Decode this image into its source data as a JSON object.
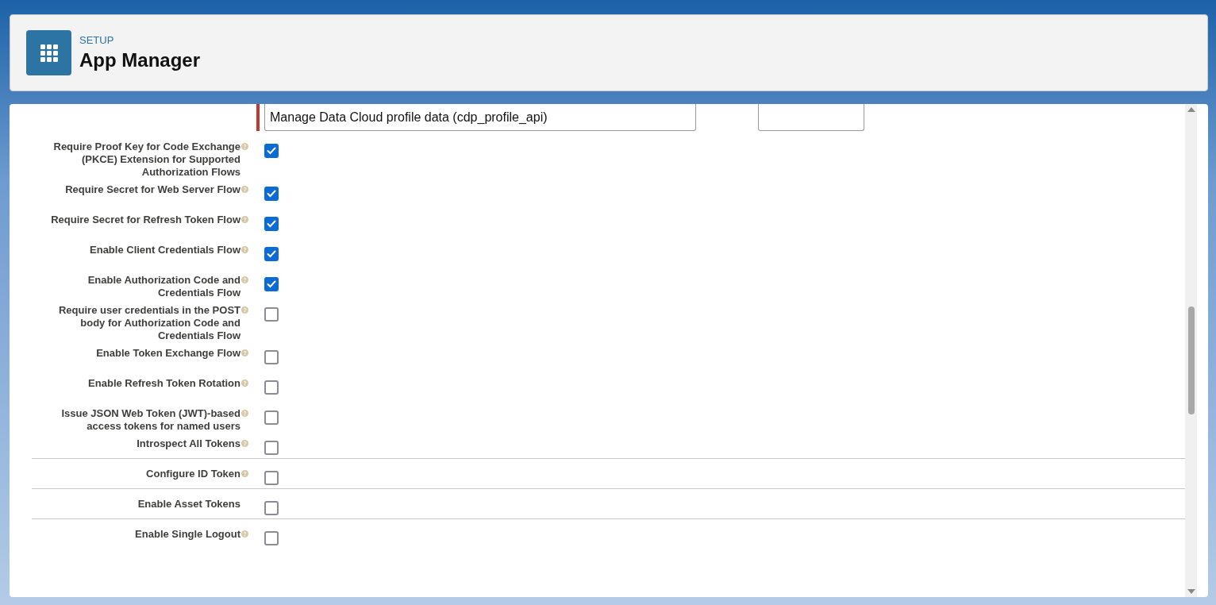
{
  "header": {
    "eyebrow": "SETUP",
    "title": "App Manager"
  },
  "scopes": {
    "selected_item": "Manage Data Cloud profile data (cdp_profile_api)",
    "required": true
  },
  "settings": [
    {
      "label": "Require Proof Key for Code Exchange (PKCE) Extension for Supported Authorization Flows",
      "help": true,
      "checked": true,
      "divider_above": false
    },
    {
      "label": "Require Secret for Web Server Flow",
      "help": true,
      "checked": true,
      "divider_above": false
    },
    {
      "label": "Require Secret for Refresh Token Flow",
      "help": true,
      "checked": true,
      "divider_above": false
    },
    {
      "label": "Enable Client Credentials Flow",
      "help": true,
      "checked": true,
      "divider_above": false
    },
    {
      "label": "Enable Authorization Code and Credentials Flow",
      "help": true,
      "checked": true,
      "divider_above": false
    },
    {
      "label": "Require user credentials in the POST body for Authorization Code and Credentials Flow",
      "help": true,
      "checked": false,
      "divider_above": false
    },
    {
      "label": "Enable Token Exchange Flow",
      "help": true,
      "checked": false,
      "divider_above": false
    },
    {
      "label": "Enable Refresh Token Rotation",
      "help": true,
      "checked": false,
      "divider_above": false
    },
    {
      "label": "Issue JSON Web Token (JWT)-based access tokens for named users",
      "help": true,
      "checked": false,
      "divider_above": false
    },
    {
      "label": "Introspect All Tokens",
      "help": true,
      "checked": false,
      "divider_above": false
    },
    {
      "label": "Configure ID Token",
      "help": true,
      "checked": false,
      "divider_above": true
    },
    {
      "label": "Enable Asset Tokens",
      "help": false,
      "checked": false,
      "divider_above": true
    },
    {
      "label": "Enable Single Logout",
      "help": true,
      "checked": false,
      "divider_above": true
    }
  ]
}
